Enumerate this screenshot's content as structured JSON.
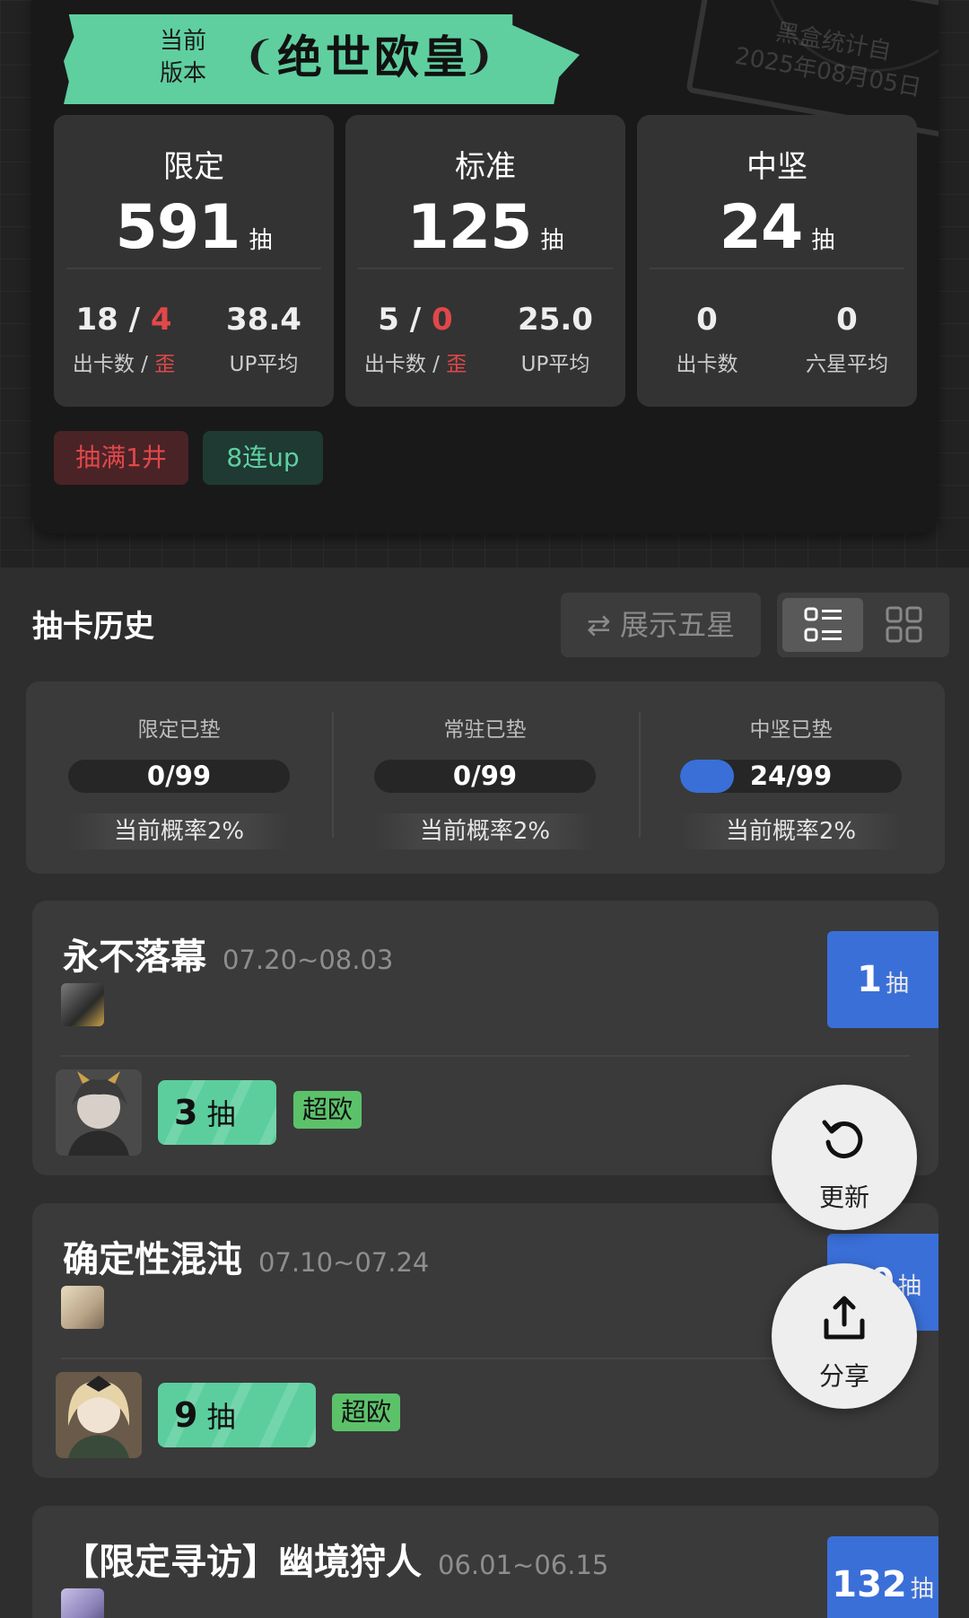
{
  "summary": {
    "version_label": "当前\n版本",
    "version_name": "绝世欧皇",
    "stamp_line1": "黑盒统计自",
    "stamp_line2": "2025年08月05日",
    "stats": [
      {
        "title": "限定",
        "total": "591",
        "unit": "抽",
        "cards": "18",
        "sep": " / ",
        "off": "4",
        "cards_label": "出卡数 / ",
        "off_label": "歪",
        "avg": "38.4",
        "avg_label": "UP平均"
      },
      {
        "title": "标准",
        "total": "125",
        "unit": "抽",
        "cards": "5",
        "sep": " / ",
        "off": "0",
        "cards_label": "出卡数 / ",
        "off_label": "歪",
        "avg": "25.0",
        "avg_label": "UP平均"
      },
      {
        "title": "中坚",
        "total": "24",
        "unit": "抽",
        "cards": "0",
        "cards_label": "出卡数",
        "avg": "0",
        "avg_label": "六星平均"
      }
    ],
    "tags": [
      {
        "label": "抽满1井",
        "bg": "#4a2326",
        "color": "#e0484b"
      },
      {
        "label": "8连up",
        "bg": "#1e3a33",
        "color": "#5fcfa0"
      }
    ]
  },
  "history": {
    "title": "抽卡历史",
    "filter_label": "⇄ 展示五星",
    "view_modes": [
      "list-view-icon",
      "grid-view-icon"
    ]
  },
  "pity": [
    {
      "label": "限定已垫",
      "value": "0/99",
      "fraction": 0.0,
      "rate": "当前概率2%"
    },
    {
      "label": "常驻已垫",
      "value": "0/99",
      "fraction": 0.0,
      "rate": "当前概率2%"
    },
    {
      "label": "中坚已垫",
      "value": "24/99",
      "fraction": 0.2424,
      "rate": "当前概率2%"
    }
  ],
  "banners": [
    {
      "name": "永不落幕",
      "dates": "07.20~08.03",
      "count": "1",
      "unit": "抽",
      "pull": "3",
      "pull_unit": "抽",
      "luck": "超欧"
    },
    {
      "name": "确定性混沌",
      "dates": "07.10~07.24",
      "count": "10",
      "unit": "抽",
      "pull": "9",
      "pull_unit": "抽",
      "luck": "超欧"
    },
    {
      "name": "【限定寻访】幽境狩人",
      "dates": "06.01~06.15",
      "count": "132",
      "unit": "抽"
    }
  ],
  "fab": {
    "refresh_label": "更新",
    "share_label": "分享"
  },
  "colors": {
    "accent_green": "#5fcfa0",
    "accent_blue": "#3a6fd8",
    "red": "#e2474a",
    "luck_green": "#5cc26a"
  }
}
